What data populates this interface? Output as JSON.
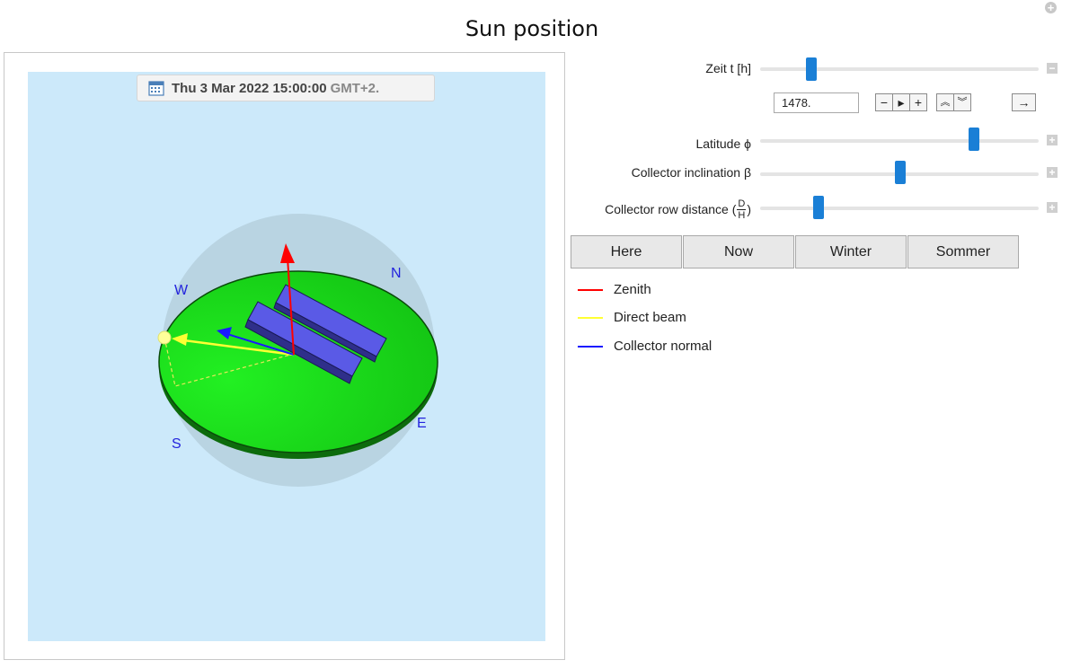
{
  "title": "Sun position",
  "date_badge": {
    "datetime": "Thu 3 Mar 2022 15:00:00",
    "timezone": "GMT+2."
  },
  "compass": {
    "north": "N",
    "south": "S",
    "east": "E",
    "west": "W"
  },
  "controls": {
    "time": {
      "label": "Zeit t [h]",
      "value": "1478.",
      "slider_fraction": 0.17
    },
    "latitude": {
      "label": "Latitude ϕ",
      "slider_fraction": 0.76
    },
    "inclination": {
      "label": "Collector inclination β",
      "slider_fraction": 0.49
    },
    "row_distance": {
      "label_prefix": "Collector row distance (",
      "frac_num": "D",
      "frac_den": "H",
      "label_suffix": ")",
      "slider_fraction": 0.2
    }
  },
  "buttons": [
    "Here",
    "Now",
    "Winter",
    "Sommer"
  ],
  "legend": [
    {
      "label": "Zenith",
      "color": "#ff0000"
    },
    {
      "label": "Direct beam",
      "color": "#ffff33"
    },
    {
      "label": "Collector normal",
      "color": "#1a1aff"
    }
  ],
  "colors": {
    "ground": "#1ed61e",
    "sky_dome": "#b9d4e2",
    "background": "#cce9fa",
    "panel": "#5656dd",
    "slider_thumb": "#1a7fd6"
  }
}
